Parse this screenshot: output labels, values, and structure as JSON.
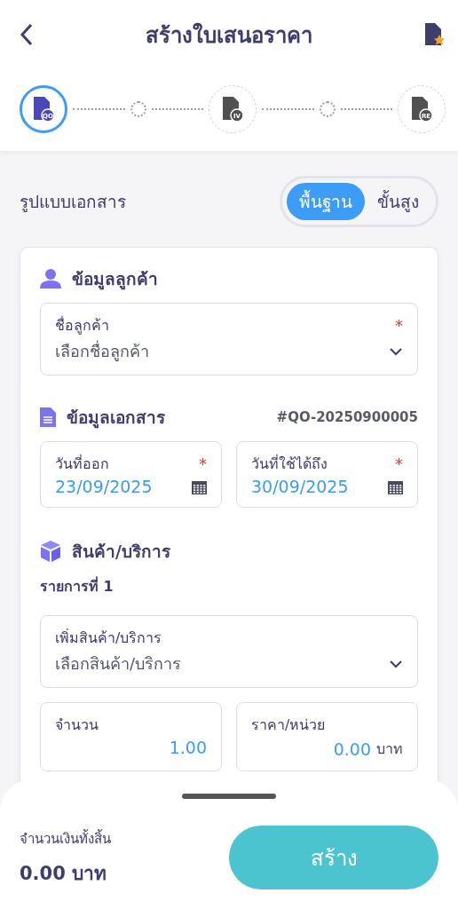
{
  "header": {
    "title": "สร้างใบเสนอราคา"
  },
  "steps": [
    {
      "badge": "QO",
      "selected": true
    },
    {
      "badge": "IV",
      "selected": false
    },
    {
      "badge": "RE",
      "selected": false
    }
  ],
  "document_format": {
    "label": "รูปแบบเอกสาร",
    "options": [
      {
        "label": "พื้นฐาน",
        "selected": true
      },
      {
        "label": "ขั้นสูง",
        "selected": false
      }
    ]
  },
  "customer": {
    "title": "ข้อมูลลูกค้า",
    "field": {
      "label": "ชื่อลูกค้า",
      "required_mark": "*",
      "placeholder": "เลือกชื่อลูกค้า"
    }
  },
  "document": {
    "title": "ข้อมูลเอกสาร",
    "number": "#QO-20250900005",
    "fields": [
      {
        "label": "วันที่ออก",
        "required_mark": "*",
        "value": "23/09/2025"
      },
      {
        "label": "วันที่ใช้ได้ถึง",
        "required_mark": "*",
        "value": "30/09/2025"
      }
    ]
  },
  "products": {
    "title": "สินค้า/บริการ",
    "item_label": "รายการที่ 1",
    "product_field": {
      "label": "เพิ่มสินค้า/บริการ",
      "placeholder": "เลือกสินค้า/บริการ"
    },
    "quantity": {
      "label": "จำนวน",
      "value": "1.00"
    },
    "price": {
      "label": "ราคา/หน่วย",
      "value": "0.00",
      "unit": "บาท"
    }
  },
  "footer": {
    "total_label": "จำนวนเงินทั้งสิ้น",
    "total_value": "0.00 บาท",
    "create_button": "สร้าง"
  }
}
